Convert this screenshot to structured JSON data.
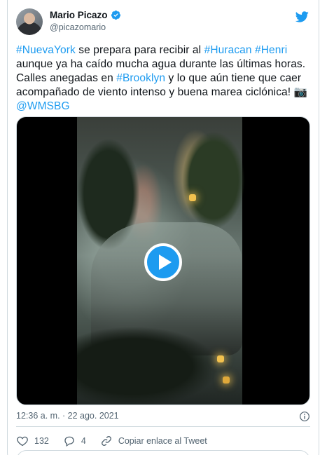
{
  "author": {
    "name": "Mario Picazo",
    "handle": "@picazomario",
    "verified": true
  },
  "tweet": {
    "segments": [
      {
        "text": "#NuevaYork",
        "link": true
      },
      {
        "text": " se prepara para recibir al ",
        "link": false
      },
      {
        "text": "#Huracan",
        "link": true
      },
      {
        "text": " ",
        "link": false
      },
      {
        "text": "#Henri",
        "link": true
      },
      {
        "text": " aunque ya ha caído mucha agua durante las últimas horas. Calles anegadas en ",
        "link": false
      },
      {
        "text": "#Brooklyn",
        "link": true
      },
      {
        "text": " y lo que aún tiene que caer acompañado de viento intenso y buena marea ciclónica! ",
        "link": false
      },
      {
        "text": "📷",
        "link": false
      },
      {
        "text": "@WMSBG",
        "link": true
      }
    ]
  },
  "meta": {
    "timestamp": "12:36 a. m. · 22 ago. 2021"
  },
  "actions": {
    "likes": "132",
    "replies": "4",
    "copy_link": "Copiar enlace al Tweet"
  },
  "colors": {
    "accent": "#1d9bf0",
    "text": "#0f1419",
    "muted": "#536471",
    "border": "#cfd9de"
  },
  "icons": {
    "brand": "twitter-bird-icon",
    "verified": "verified-badge-icon",
    "info": "info-icon",
    "like": "heart-icon",
    "reply": "reply-icon",
    "link": "link-icon",
    "play": "play-icon"
  }
}
